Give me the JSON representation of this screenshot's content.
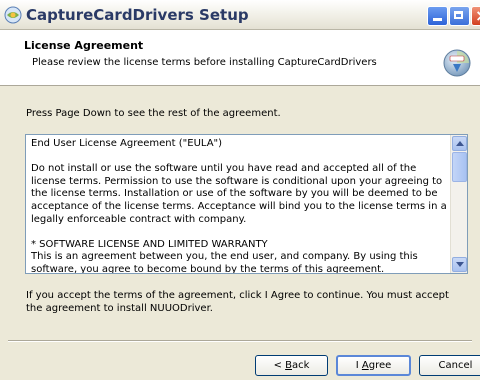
{
  "window": {
    "title": "CaptureCardDrivers Setup",
    "title_icon": "installer-icon",
    "accent": "#2a3a66"
  },
  "header": {
    "title": "License Agreement",
    "subtitle": "Please review the license terms before installing CaptureCardDrivers",
    "icon": "license-globe-icon"
  },
  "instructions": "Press Page Down to see the rest of the agreement.",
  "license": {
    "paragraphs": [
      "End User License Agreement (\"EULA\")",
      "Do not install or use the software until you have read and accepted all of the license terms. Permission to use the software is conditional upon your agreeing to the license terms. Installation or use of the software by you will be deemed to be acceptance of the license terms. Acceptance will bind you to the license terms in a legally enforceable contract with company.",
      "* SOFTWARE LICENSE AND LIMITED WARRANTY",
      "This is an agreement between you, the end user, and company. By using this software, you agree to become bound by the terms of this agreement."
    ]
  },
  "accept_note": "If you accept the terms of the agreement, click I Agree to continue. You must accept the agreement to install NUUODriver.",
  "buttons": {
    "back_prefix": "< ",
    "back_key": "B",
    "back_rest": "ack",
    "agree_prefix": "I ",
    "agree_key": "A",
    "agree_rest": "gree",
    "cancel": "Cancel"
  }
}
